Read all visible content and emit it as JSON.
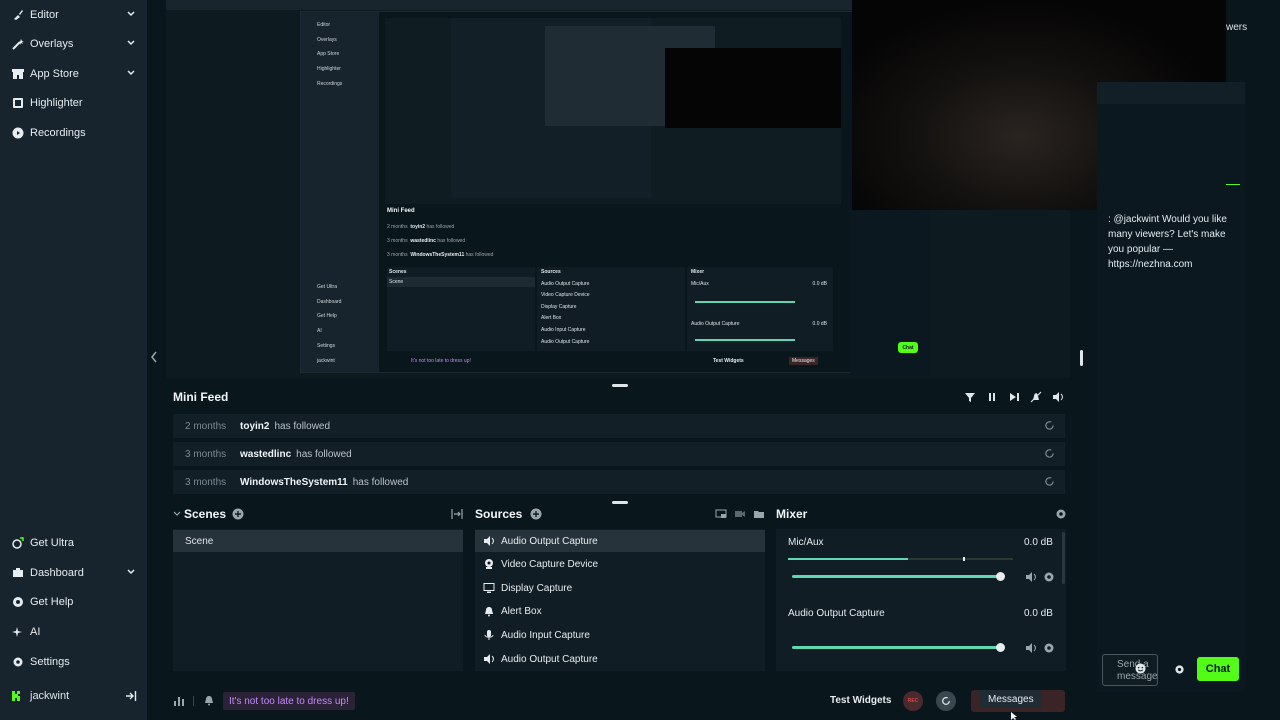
{
  "sidebar": {
    "items": [
      {
        "label": "Editor",
        "icon": "brush-icon",
        "has_chevron": true
      },
      {
        "label": "Overlays",
        "icon": "magic-wand-icon",
        "has_chevron": true
      },
      {
        "label": "App Store",
        "icon": "store-icon",
        "has_chevron": true
      },
      {
        "label": "Highlighter",
        "icon": "film-icon",
        "has_chevron": false
      },
      {
        "label": "Recordings",
        "icon": "play-circle-icon",
        "has_chevron": false
      }
    ],
    "bottom_items": [
      {
        "label": "Get Ultra",
        "icon": "ultra-icon",
        "has_chevron": false
      },
      {
        "label": "Dashboard",
        "icon": "dashboard-icon",
        "has_chevron": true
      },
      {
        "label": "Get Help",
        "icon": "help-icon",
        "has_chevron": false
      },
      {
        "label": "AI",
        "icon": "sparkle-icon",
        "has_chevron": false
      },
      {
        "label": "Settings",
        "icon": "gear-icon",
        "has_chevron": false
      }
    ],
    "user": {
      "name": "jackwint",
      "icon": "kick-logo-icon"
    }
  },
  "mini_feed": {
    "title": "Mini Feed",
    "rows": [
      {
        "ago": "2 months",
        "user": "toyin2",
        "action": "has followed"
      },
      {
        "ago": "3 months",
        "user": "wastedlinc",
        "action": "has followed"
      },
      {
        "ago": "3 months",
        "user": "WindowsTheSystem11",
        "action": "has followed"
      }
    ]
  },
  "scenes": {
    "title": "Scenes",
    "items": [
      "Scene"
    ]
  },
  "sources": {
    "title": "Sources",
    "items": [
      {
        "label": "Audio Output Capture",
        "icon": "speaker-icon",
        "selected": true
      },
      {
        "label": "Video Capture Device",
        "icon": "webcam-icon",
        "selected": false
      },
      {
        "label": "Display Capture",
        "icon": "monitor-icon",
        "selected": false
      },
      {
        "label": "Alert Box",
        "icon": "bell-icon",
        "selected": false
      },
      {
        "label": "Audio Input Capture",
        "icon": "microphone-icon",
        "selected": false
      },
      {
        "label": "Audio Output Capture",
        "icon": "speaker-icon",
        "selected": false
      }
    ]
  },
  "mixer": {
    "title": "Mixer",
    "channels": [
      {
        "label": "Mic/Aux",
        "db": "0.0 dB",
        "level": 0.92
      },
      {
        "label": "Audio Output Capture",
        "db": "0.0 dB",
        "level": 0.92
      }
    ]
  },
  "footer": {
    "notification": "It's not too late to dress up!",
    "test_widgets": "Test Widgets",
    "rec_label": "REC",
    "messages": "Messages"
  },
  "chat": {
    "header_fragment": "wers",
    "message": ": @jackwint Would you like many viewers? Let's make you popular — https://nezhna.com",
    "input_placeholder": "Send a message",
    "send_label": "Chat"
  },
  "preview_mini": {
    "nav": [
      "Editor",
      "Overlays",
      "App Store",
      "Highlighter",
      "Recordings"
    ],
    "nav_bottom": [
      "Get Ultra",
      "Dashboard",
      "Get Help",
      "AI",
      "Settings",
      "jackwint"
    ],
    "feed_title": "Mini Feed",
    "feed_rows": [
      {
        "ago": "2 months",
        "user": "toyin2",
        "action": "has followed"
      },
      {
        "ago": "3 months",
        "user": "wastedlinc",
        "action": "has followed"
      },
      {
        "ago": "3 months",
        "user": "WindowsTheSystem11",
        "action": "has followed"
      }
    ],
    "scenes_title": "Scenes",
    "scene": "Scene",
    "sources_title": "Sources",
    "sources": [
      "Audio Output Capture",
      "Video Capture Device",
      "Display Capture",
      "Alert Box",
      "Audio Input Capture",
      "Audio Output Capture"
    ],
    "mixer_title": "Mixer",
    "mic": "Mic/Aux",
    "mic_db": "0.0 dB",
    "out": "Audio Output Capture",
    "out_db": "0.0 dB",
    "notification": "It's not too late to dress up!",
    "test_widgets": "Test Widgets",
    "messages": "Messages",
    "chat_btn": "Chat"
  }
}
